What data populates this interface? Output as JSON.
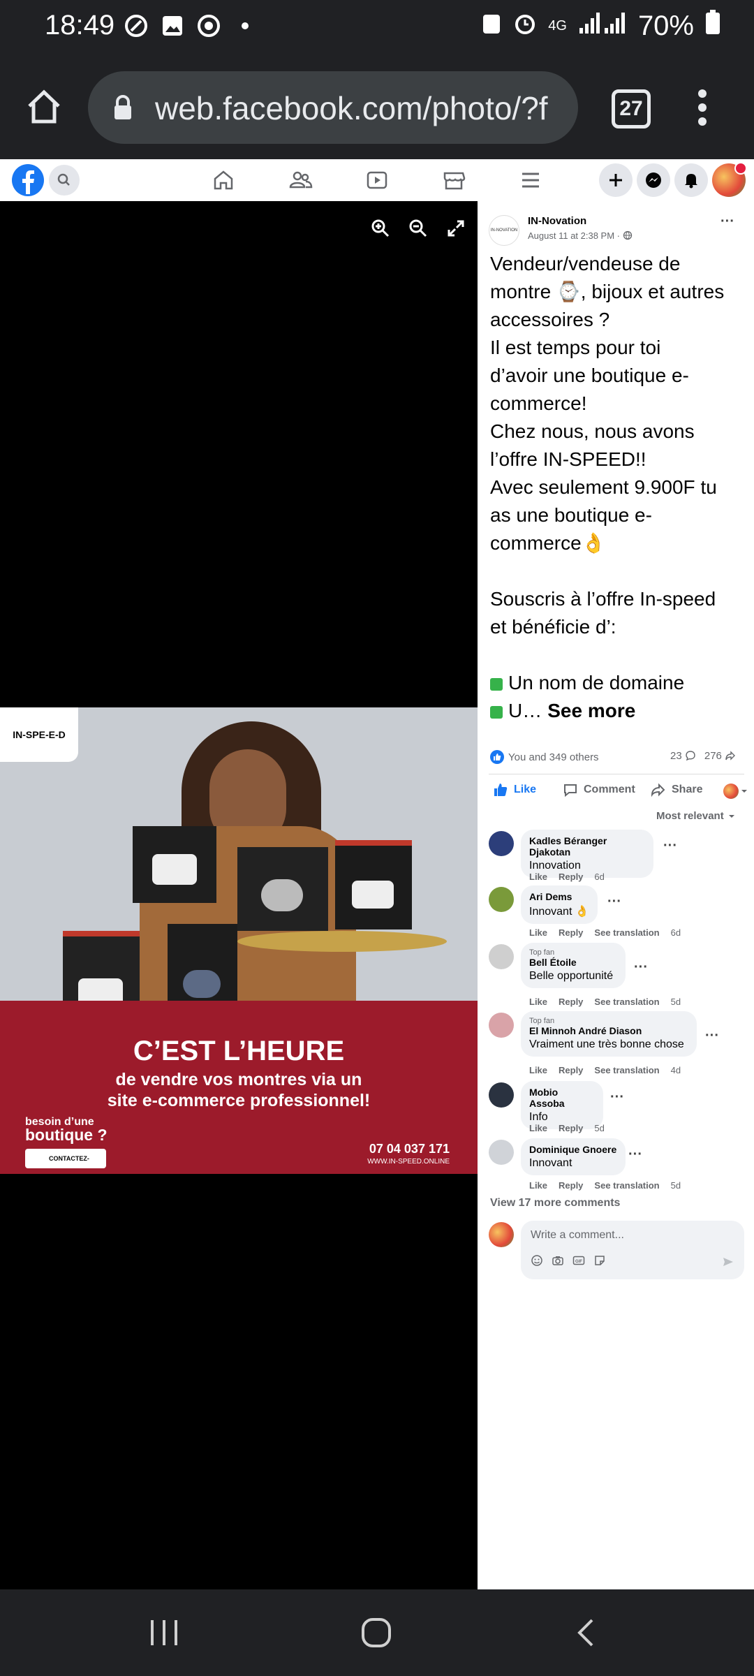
{
  "status": {
    "time": "18:49",
    "network": "4G",
    "battery": "70%"
  },
  "browser": {
    "url": "web.facebook.com/photo/?f",
    "tab_count": "27"
  },
  "viewer": {
    "zoom_in": "zoom-in-icon",
    "zoom_out": "zoom-out-icon",
    "fullscreen": "fullscreen-icon"
  },
  "ad": {
    "logo": "IN-SPE-E-D",
    "headline": "C’EST L’HEURE",
    "subline1": "de vendre vos montres via un",
    "subline2": "site e-commerce professionnel!",
    "question_small": "besoin d’une",
    "question_big": "boutique ?",
    "cta": "CONTACTEZ-NOUS",
    "phone": "07 04 037 171",
    "website": "WWW.IN-SPEED.ONLINE"
  },
  "post": {
    "author": "IN-Novation",
    "meta": "August 11 at 2:38 PM ·",
    "lines": [
      "Vendeur/vendeuse de",
      "montre ⌚, bijoux et autres",
      "accessoires ?",
      "Il est temps pour toi",
      "d’avoir une boutique e-",
      "commerce!",
      "Chez nous, nous avons",
      "l’offre IN-SPEED!!",
      "Avec seulement 9.900F tu",
      "as une boutique e-",
      "commerce👌",
      "",
      "Souscris à l’offre In-speed",
      "et bénéficie d’:",
      "",
      "Un nom de domaine",
      "U…"
    ],
    "see_more": "See more",
    "reactions": "You and 349 others",
    "comments_count": "23",
    "shares_count": "276",
    "like": "Like",
    "comment": "Comment",
    "share": "Share",
    "sort": "Most relevant"
  },
  "comments": [
    {
      "name": "Kadles Béranger Djakotan",
      "text": "Innovation",
      "top_fan": "",
      "translate": "",
      "time": "6d"
    },
    {
      "name": "Ari Dems",
      "text": "Innovant 👌",
      "top_fan": "",
      "translate": "See translation",
      "time": "6d"
    },
    {
      "name": "Bell Étoile",
      "text": "Belle opportunité",
      "top_fan": "Top fan",
      "translate": "See translation",
      "time": "5d"
    },
    {
      "name": "El Minnoh André Diason",
      "text": "Vraiment une très bonne chose",
      "top_fan": "Top fan",
      "translate": "See translation",
      "time": "4d"
    },
    {
      "name": "Mobio Assoba",
      "text": "Info",
      "top_fan": "",
      "translate": "",
      "time": "5d"
    },
    {
      "name": "Dominique Gnoere",
      "text": "Innovant",
      "top_fan": "",
      "translate": "See translation",
      "time": "5d"
    }
  ],
  "comment_actions": {
    "like": "Like",
    "reply": "Reply"
  },
  "more_comments": "View 17 more comments",
  "composer": {
    "placeholder": "Write a comment..."
  }
}
